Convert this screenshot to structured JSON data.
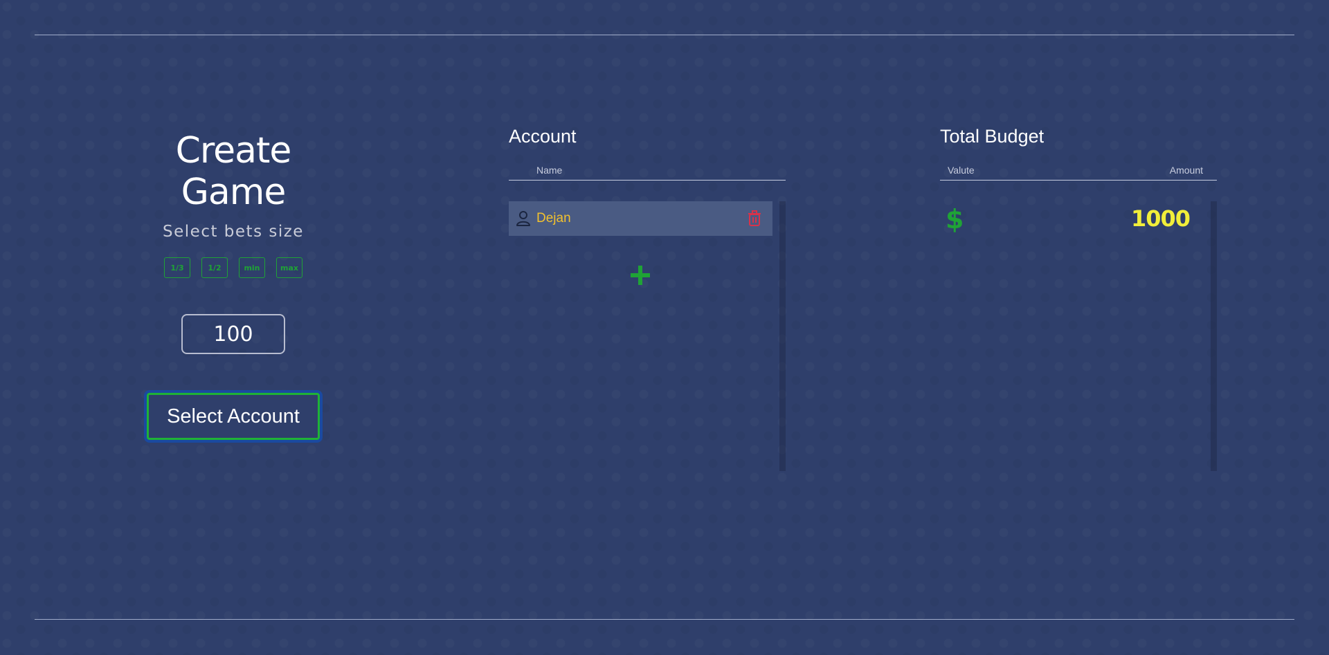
{
  "create_game": {
    "title": "Create Game",
    "subtitle": "Select bets size",
    "bet_buttons": [
      "1/3",
      "1/2",
      "min",
      "max"
    ],
    "bet_value": "100",
    "select_account_label": "Select Account"
  },
  "account_panel": {
    "title": "Account",
    "column_name": "Name",
    "rows": [
      {
        "name": "Dejan",
        "icon": "user-icon",
        "action_icon": "trash-icon"
      }
    ],
    "add_icon": "plus-icon"
  },
  "budget_panel": {
    "title": "Total Budget",
    "column_left": "Valute",
    "column_right": "Amount",
    "rows": [
      {
        "currency": "$",
        "amount": "1000"
      }
    ]
  },
  "colors": {
    "background": "#2f3f6b",
    "accent_green": "#1fa336",
    "name_yellow": "#f2c12e",
    "amount_yellow": "#f1ee3a",
    "delete_red": "#d9324a",
    "selected_row": "#4a5b83"
  }
}
